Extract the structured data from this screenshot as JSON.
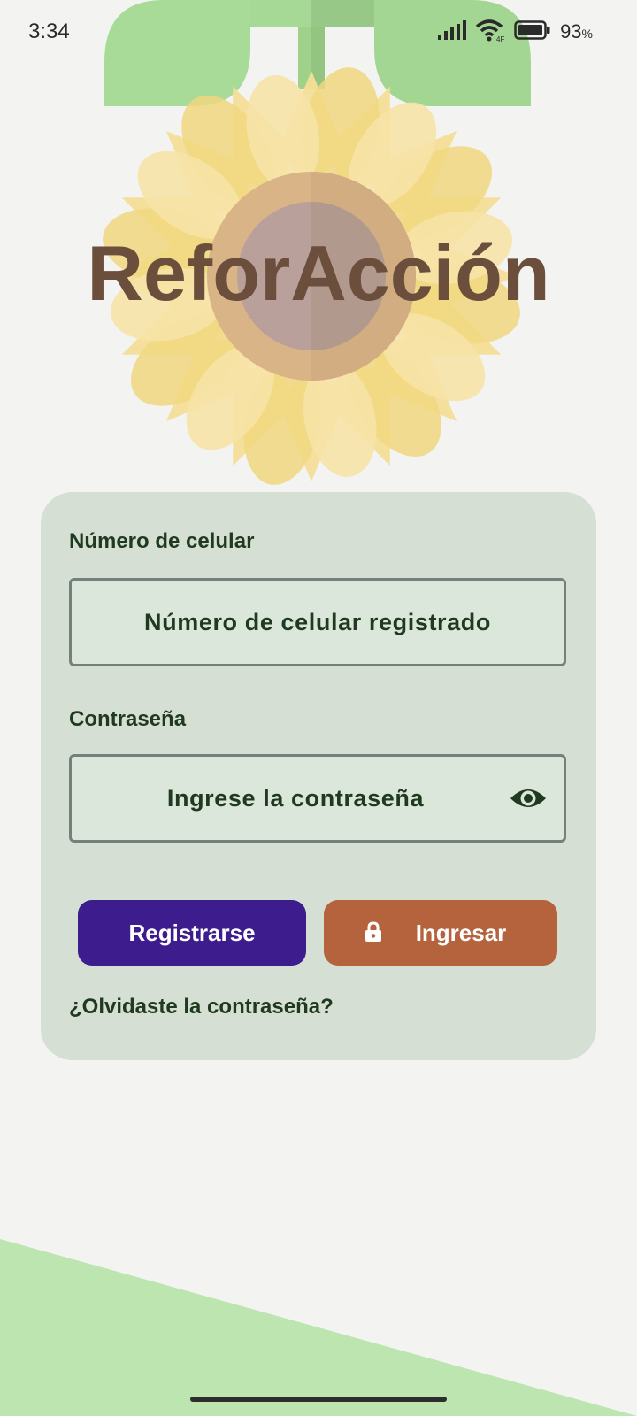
{
  "status_bar": {
    "time": "3:34",
    "battery_percent": "93",
    "battery_unit": "%",
    "icons": [
      "signal-icon",
      "wifi-icon",
      "battery-icon"
    ]
  },
  "app": {
    "title": "ReforAcción"
  },
  "login_form": {
    "phone_label": "Número de celular",
    "phone_placeholder": "Número de celular registrado",
    "password_label": "Contraseña",
    "password_placeholder": "Ingrese la contraseña",
    "register_button": "Registrarse",
    "login_button": "Ingresar",
    "forgot_password": "¿Olvidaste la contraseña?"
  },
  "colors": {
    "background": "#f3f3f2",
    "card": "#d5dfd3",
    "register_button": "#3d1c8e",
    "login_button": "#b4633d",
    "title": "#6b4f3c",
    "text": "#1f3a1f",
    "leaf_green": "#a6d896",
    "petal_yellow": "#f2d98a",
    "bottom_green": "#bde5b0"
  }
}
